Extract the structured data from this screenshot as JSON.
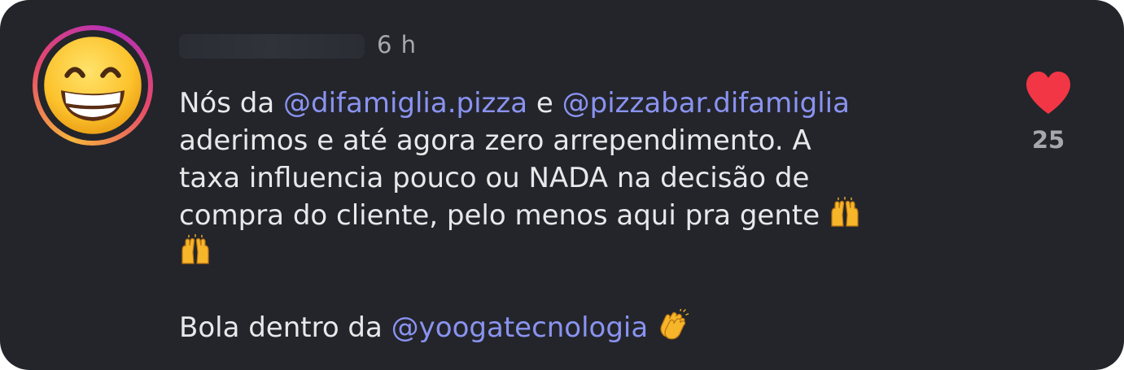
{
  "comment": {
    "username": "",
    "time": "6 h",
    "line1_a": "Nós da ",
    "mention1": "@difamiglia.pizza",
    "line1_b": " e ",
    "mention2": "@pizzabar.difamiglia",
    "line2": "aderimos e até agora zero arrependimento. A",
    "line3": "taxa influencia pouco ou NADA na decisão de",
    "line4": "compra do cliente, pelo menos aqui pra gente ",
    "line7_a": "Bola dentro da ",
    "mention3": "@yoogatecnologia",
    "like_count": "25"
  },
  "icons": {
    "avatar": "grinning-face-emoji",
    "like": "heart-icon",
    "raising_hands": "raising-hands-emoji",
    "clapping": "clapping-hands-emoji"
  },
  "colors": {
    "background": "#23252b",
    "text": "#e8e8ea",
    "muted": "#a6a8ad",
    "mention": "#8a93f0",
    "heart": "#f23645"
  }
}
